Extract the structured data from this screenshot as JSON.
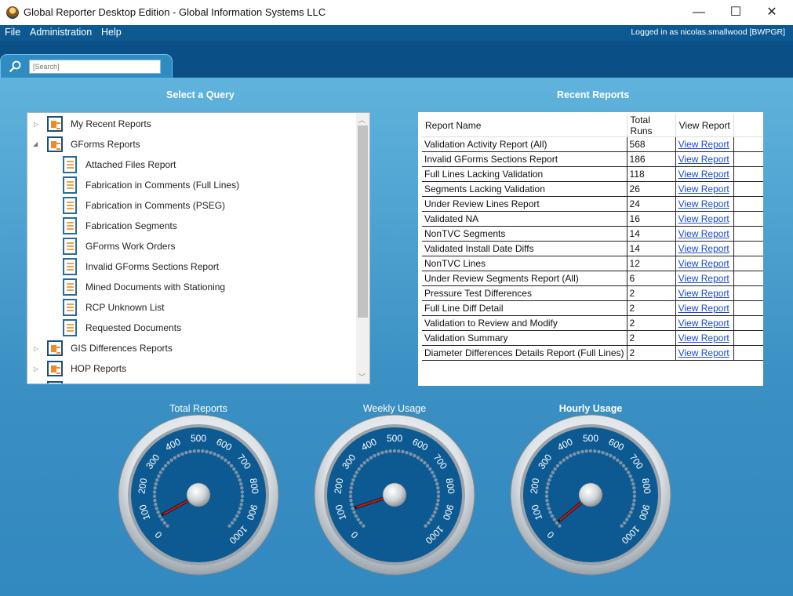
{
  "window": {
    "title": "Global Reporter Desktop Edition - Global Information Systems LLC",
    "minimize": "—",
    "maximize": "☐",
    "close": "✕"
  },
  "menu": {
    "items": [
      "File",
      "Administration",
      "Help"
    ],
    "logged_in_label": "Logged in as",
    "user": "nicolas.smallwood [BWPGR]"
  },
  "search": {
    "placeholder": "[Search]"
  },
  "query_panel": {
    "title": "Select a Query",
    "tree": [
      {
        "label": "My Recent Reports",
        "type": "folder",
        "expanded": false
      },
      {
        "label": "GForms Reports",
        "type": "folder",
        "expanded": true
      },
      {
        "label": "Attached Files Report",
        "type": "doc"
      },
      {
        "label": "Fabrication in Comments (Full Lines)",
        "type": "doc"
      },
      {
        "label": "Fabrication in Comments (PSEG)",
        "type": "doc"
      },
      {
        "label": "Fabrication Segments",
        "type": "doc"
      },
      {
        "label": "GForms Work Orders",
        "type": "doc"
      },
      {
        "label": "Invalid GForms Sections Report",
        "type": "doc"
      },
      {
        "label": "Mined Documents with Stationing",
        "type": "doc"
      },
      {
        "label": "RCP Unknown List",
        "type": "doc"
      },
      {
        "label": "Requested Documents",
        "type": "doc"
      },
      {
        "label": "GIS Differences Reports",
        "type": "folder",
        "expanded": false
      },
      {
        "label": "HOP Reports",
        "type": "folder",
        "expanded": false
      }
    ]
  },
  "recent_reports": {
    "title": "Recent Reports",
    "columns": [
      "Report Name",
      "Total Runs",
      "View Report"
    ],
    "link_text": "View Report",
    "rows": [
      {
        "name": "Validation Activity Report (All)",
        "runs": "568"
      },
      {
        "name": "Invalid GForms Sections Report",
        "runs": "186"
      },
      {
        "name": "Full Lines Lacking Validation",
        "runs": "118"
      },
      {
        "name": "Segments Lacking Validation",
        "runs": "26"
      },
      {
        "name": "Under Review Lines Report",
        "runs": "24"
      },
      {
        "name": "Validated NA",
        "runs": "16"
      },
      {
        "name": "NonTVC Segments",
        "runs": "14"
      },
      {
        "name": "Validated Install Date Diffs",
        "runs": "14"
      },
      {
        "name": "NonTVC Lines",
        "runs": "12"
      },
      {
        "name": "Under Review Segments Report (All)",
        "runs": "6"
      },
      {
        "name": "Pressure Test Differences",
        "runs": "2"
      },
      {
        "name": "Full Line Diff Detail",
        "runs": "2"
      },
      {
        "name": "Validation to Review and Modify",
        "runs": "2"
      },
      {
        "name": "Validation Summary",
        "runs": "2"
      },
      {
        "name": "Diameter Differences Details Report (Full Lines)",
        "runs": "2"
      }
    ]
  },
  "gauges": [
    {
      "title": "Total Reports",
      "value": 60,
      "bold": false
    },
    {
      "title": "Weekly Usage",
      "value": 100,
      "bold": false
    },
    {
      "title": "Hourly Usage",
      "value": 20,
      "bold": true
    }
  ],
  "gauge_scale": {
    "ticks": [
      "0",
      "100",
      "200",
      "300",
      "400",
      "500",
      "600",
      "700",
      "800",
      "900",
      "1000"
    ]
  },
  "colors": {
    "menu_bg": "#0d5a93",
    "gauge_face": "#0d5a93",
    "needle": "#d01818",
    "link": "#1a4bd0"
  }
}
